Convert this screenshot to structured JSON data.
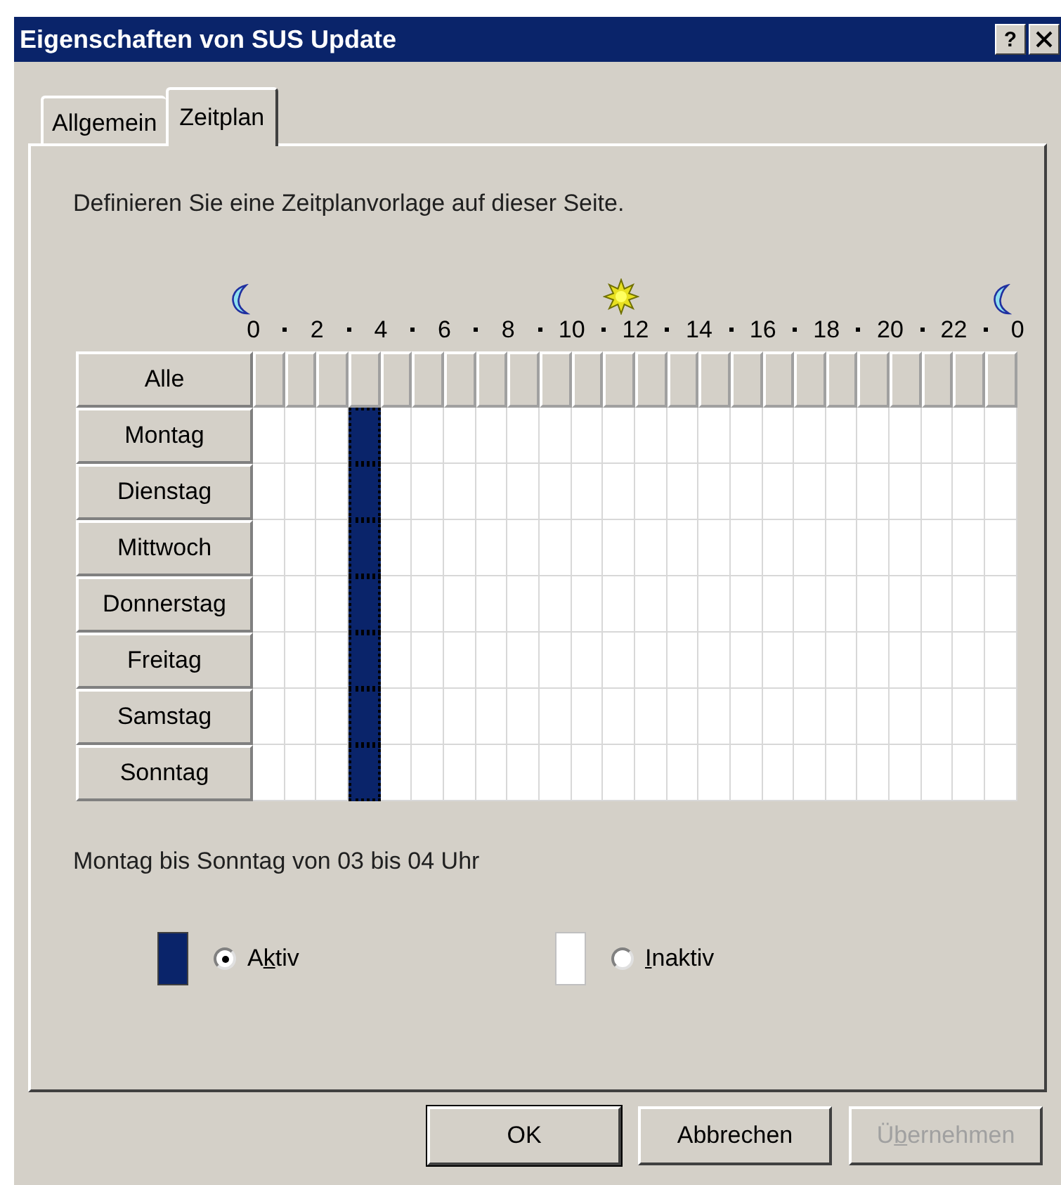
{
  "window": {
    "title": "Eigenschaften von SUS Update",
    "help_button": "?"
  },
  "tabs": [
    {
      "label": "Allgemein",
      "selected": false
    },
    {
      "label": "Zeitplan",
      "selected": true
    }
  ],
  "description": "Definieren Sie eine Zeitplanvorlage auf dieser Seite.",
  "hour_labels": [
    "0",
    "2",
    "4",
    "6",
    "8",
    "10",
    "12",
    "14",
    "16",
    "18",
    "20",
    "22",
    "0"
  ],
  "schedule": {
    "all_label": "Alle",
    "days": [
      {
        "label": "Montag",
        "hours": [
          false,
          false,
          false,
          true,
          false,
          false,
          false,
          false,
          false,
          false,
          false,
          false,
          false,
          false,
          false,
          false,
          false,
          false,
          false,
          false,
          false,
          false,
          false,
          false
        ]
      },
      {
        "label": "Dienstag",
        "hours": [
          false,
          false,
          false,
          true,
          false,
          false,
          false,
          false,
          false,
          false,
          false,
          false,
          false,
          false,
          false,
          false,
          false,
          false,
          false,
          false,
          false,
          false,
          false,
          false
        ]
      },
      {
        "label": "Mittwoch",
        "hours": [
          false,
          false,
          false,
          true,
          false,
          false,
          false,
          false,
          false,
          false,
          false,
          false,
          false,
          false,
          false,
          false,
          false,
          false,
          false,
          false,
          false,
          false,
          false,
          false
        ]
      },
      {
        "label": "Donnerstag",
        "hours": [
          false,
          false,
          false,
          true,
          false,
          false,
          false,
          false,
          false,
          false,
          false,
          false,
          false,
          false,
          false,
          false,
          false,
          false,
          false,
          false,
          false,
          false,
          false,
          false
        ]
      },
      {
        "label": "Freitag",
        "hours": [
          false,
          false,
          false,
          true,
          false,
          false,
          false,
          false,
          false,
          false,
          false,
          false,
          false,
          false,
          false,
          false,
          false,
          false,
          false,
          false,
          false,
          false,
          false,
          false
        ]
      },
      {
        "label": "Samstag",
        "hours": [
          false,
          false,
          false,
          true,
          false,
          false,
          false,
          false,
          false,
          false,
          false,
          false,
          false,
          false,
          false,
          false,
          false,
          false,
          false,
          false,
          false,
          false,
          false,
          false
        ]
      },
      {
        "label": "Sonntag",
        "hours": [
          false,
          false,
          false,
          true,
          false,
          false,
          false,
          false,
          false,
          false,
          false,
          false,
          false,
          false,
          false,
          false,
          false,
          false,
          false,
          false,
          false,
          false,
          false,
          false
        ]
      }
    ]
  },
  "summary": "Montag bis Sonntag von 03 bis 04 Uhr",
  "legend": [
    {
      "kind": "active",
      "label": {
        "before": "A",
        "accel": "k",
        "after": "tiv"
      },
      "selected": true
    },
    {
      "kind": "inactive",
      "label": {
        "accel": "I",
        "after": "naktiv"
      },
      "selected": false
    }
  ],
  "buttons": [
    {
      "label": {
        "before": "OK"
      },
      "default": true,
      "disabled": false
    },
    {
      "label": {
        "before": "Abbrechen"
      },
      "default": false,
      "disabled": false
    },
    {
      "label": {
        "before": "Ü",
        "accel": "b",
        "after": "ernehmen"
      },
      "default": false,
      "disabled": true
    }
  ]
}
